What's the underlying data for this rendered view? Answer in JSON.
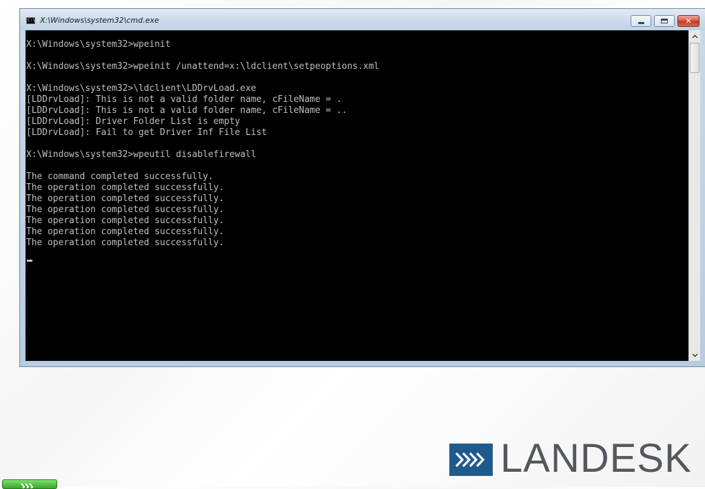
{
  "window": {
    "title": "X:\\Windows\\system32\\cmd.exe",
    "icon": "cmd-icon",
    "icon_text": "C:\\",
    "controls": [
      "minimize-icon",
      "maximize-icon",
      "close-icon"
    ],
    "close_glyph": "✕"
  },
  "console": {
    "text": "X:\\Windows\\system32>wpeinit\n\nX:\\Windows\\system32>wpeinit /unattend=x:\\ldclient\\setpeoptions.xml\n\nX:\\Windows\\system32>\\ldclient\\LDDrvLoad.exe\n[LDDrvLoad]: This is not a valid folder name, cFileName = .\n[LDDrvLoad]: This is not a valid folder name, cFileName = ..\n[LDDrvLoad]: Driver Folder List is empty\n[LDDrvLoad]: Fail to get Driver Inf File List\n\nX:\\Windows\\system32>wpeutil disablefirewall\n\nThe command completed successfully.\nThe operation completed successfully.\nThe operation completed successfully.\nThe operation completed successfully.\nThe operation completed successfully.\nThe operation completed successfully.\nThe operation completed successfully.",
    "foreground": "#c0c0c0",
    "background": "#000000"
  },
  "scrollbar": {
    "up_glyph": "⌃",
    "down_glyph": "⌄"
  },
  "logo": {
    "text": "LANDESK",
    "mark_color": "#1f5a8c",
    "text_color": "#54585c"
  },
  "taskbar_button": {
    "icon": "chevron-arrows-icon",
    "color": "#3aa52a"
  }
}
